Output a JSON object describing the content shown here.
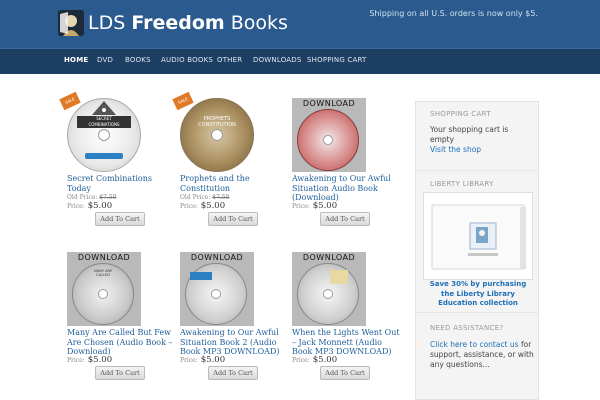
{
  "header": {
    "title_light": "LDS ",
    "title_bold": "Freedom",
    "title_tail": " Books",
    "shipping_note": "Shipping on all U.S. orders is now only $5."
  },
  "nav": {
    "items": [
      "HOME",
      "DVD",
      "BOOKS",
      "AUDIO BOOKS",
      "OTHER",
      "DOWNLOADS",
      "SHOPPING CART"
    ]
  },
  "products": [
    {
      "title": "Secret Combinations Today",
      "old_price_label": "Old Price:",
      "old_price": "$7.50",
      "price_label": "Price:",
      "price": "$5.00",
      "button": "Add To Cart",
      "image_label": ""
    },
    {
      "title": "Prophets and the Constitution",
      "old_price_label": "Old Price:",
      "old_price": "$7.50",
      "price_label": "Price:",
      "price": "$5.00",
      "button": "Add To Cart",
      "image_label": ""
    },
    {
      "title": "Awakening to Our Awful Situation Audio Book (Download)",
      "price_label": "Price:",
      "price": "$5.00",
      "button": "Add To Cart",
      "image_label": "DOWNLOAD"
    },
    {
      "title": "Many Are Called But Few Are Chosen (Audio Book – Download)",
      "price_label": "Price:",
      "price": "$5.00",
      "button": "Add To Cart",
      "image_label": "DOWNLOAD"
    },
    {
      "title": "Awakening to Our Awful Situation Book 2 (Audio Book MP3 DOWNLOAD)",
      "price_label": "Price:",
      "price": "$5.00",
      "button": "Add To Cart",
      "image_label": "DOWNLOAD"
    },
    {
      "title": "When the Lights Went Out – Jack Monnett (Audio Book MP3 DOWNLOAD)",
      "price_label": "Price:",
      "price": "$5.00",
      "button": "Add To Cart",
      "image_label": "DOWNLOAD"
    }
  ],
  "sidebar": {
    "cart_heading": "SHOPPING CART",
    "cart_text": "Your shopping cart is empty",
    "cart_link": "Visit the shop",
    "library_heading": "LIBERTY LIBRARY",
    "library_promo": "Save 30% by purchasing the Liberty Library Education collection",
    "assist_heading": "NEED ASSISTANCE?",
    "assist_link": "Click here to contact us",
    "assist_text": " for support, assistance, or with any questions..."
  },
  "colors": {
    "header_bg": "#2a5a8e",
    "nav_bg": "#1d3f63",
    "link": "#1f5e9a",
    "sale_ribbon": "#e07a27"
  }
}
